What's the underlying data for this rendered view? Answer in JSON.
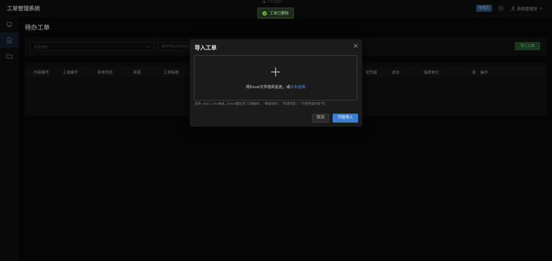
{
  "header": {
    "app_title": "工单管理系统",
    "admin_badge": "管理员",
    "user_name": "系统管理员"
  },
  "sidebar": {
    "items": [
      {
        "icon": "monitor-icon",
        "active": false
      },
      {
        "icon": "document-icon",
        "active": true
      },
      {
        "icon": "folder-icon",
        "active": false
      }
    ]
  },
  "page": {
    "title": "待办工单",
    "status_placeholder": "状态筛选",
    "search_placeholder": "搜索字段内容筛选",
    "import_button": "导入工单"
  },
  "table": {
    "columns": [
      "内部编号",
      "工单编号",
      "来电号码",
      "来源",
      "工单标题",
      "优先级",
      "状态",
      "接收单位",
      "承",
      "操作"
    ]
  },
  "toast": {
    "message": "工单已删除",
    "ghost_text": "● 工单已删除"
  },
  "modal": {
    "title": "导入工单",
    "drop_text": "将Excel文件拖到此处，或",
    "drop_link": "点击选择",
    "hint": "支持 .xlsx / .xls 格式，Excel需包含\"工单编号\"、\"来电号码\"、\"诉求内容\"、\"计划完成时间\"列",
    "cancel_label": "取消",
    "start_label": "开始导入"
  },
  "colors": {
    "accent": "#3b7fd4",
    "success": "#2f6a36",
    "link": "#4a8fd6"
  }
}
